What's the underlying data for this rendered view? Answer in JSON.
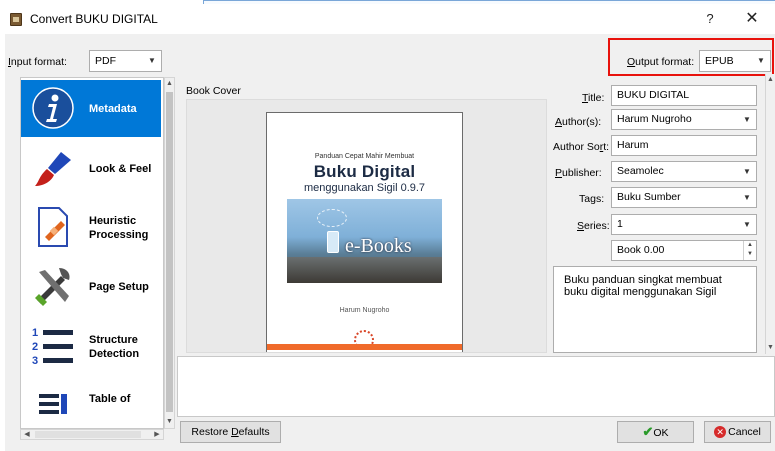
{
  "window": {
    "title": "Convert BUKU DIGITAL",
    "help_glyph": "?",
    "close_glyph": "✕"
  },
  "input_format": {
    "label_prefix": "I",
    "label_rest": "nput format:",
    "value": "PDF"
  },
  "output_format": {
    "label_prefix": "O",
    "label_rest": "utput format:",
    "value": "EPUB",
    "highlight_color": "#e8120c"
  },
  "sidebar": {
    "items": [
      {
        "label": "Metadata",
        "icon": "info-icon",
        "selected": true
      },
      {
        "label": "Look & Feel",
        "icon": "paintbrush-icon",
        "selected": false
      },
      {
        "label": "Heuristic\nProcessing",
        "icon": "document-bandage-icon",
        "selected": false
      },
      {
        "label": "Page Setup",
        "icon": "tools-icon",
        "selected": false
      },
      {
        "label": "Structure\nDetection",
        "icon": "numbered-list-icon",
        "selected": false
      },
      {
        "label": "Table of",
        "icon": "toc-icon",
        "selected": false
      }
    ],
    "selected_color": "#0078d7"
  },
  "metadata": {
    "book_cover_label": "Book Cover",
    "cover": {
      "small_text": "Panduan Cepat Mahir Membuat",
      "title": "Buku Digital",
      "subtitle": "menggunakan Sigil 0.9.7",
      "image_text": "e-Books",
      "author": "Harum Nugroho"
    },
    "fields": {
      "title_label_u": "T",
      "title_label_rest": "itle:",
      "title_value": "BUKU DIGITAL",
      "authors_label_u": "A",
      "authors_label_rest": "uthor(s):",
      "authors_value": "Harum Nugroho",
      "authorsort_label_pre": "Author So",
      "authorsort_label_u": "r",
      "authorsort_label_rest": "t:",
      "authorsort_value": "Harum",
      "publisher_label_u": "P",
      "publisher_label_rest": "ublisher:",
      "publisher_value": "Seamolec",
      "tags_label_pre": "Ta",
      "tags_label_u": "g",
      "tags_label_rest": "s:",
      "tags_value": "Buku Sumber",
      "series_label_u": "S",
      "series_label_rest": "eries:",
      "series_value": "1",
      "book_number_value": "Book 0.00"
    },
    "comments": "Buku panduan singkat membuat\nbuku digital menggunakan Sigil"
  },
  "buttons": {
    "restore_pre": "Restore ",
    "restore_u": "D",
    "restore_rest": "efaults",
    "ok": "OK",
    "cancel": "Cancel"
  }
}
